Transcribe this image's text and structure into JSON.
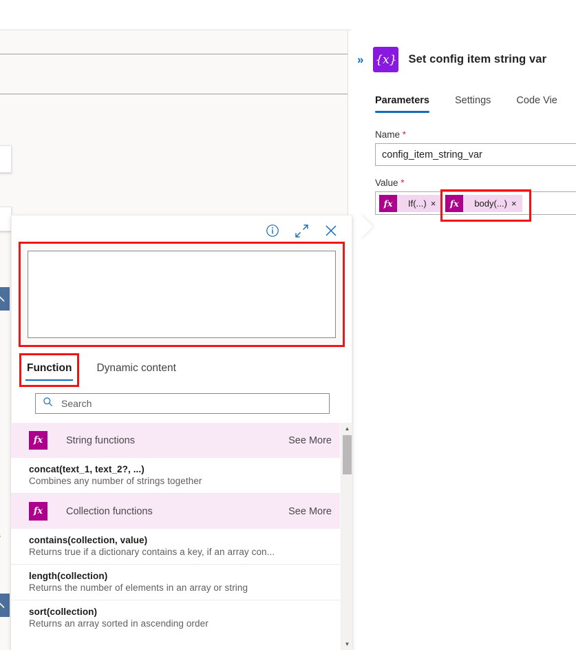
{
  "side_pane": {
    "expand_chevron": "»",
    "node_icon_glyph": "{x}",
    "title": "Set config item string var",
    "tabs": [
      {
        "label": "Parameters",
        "active": true
      },
      {
        "label": "Settings",
        "active": false
      },
      {
        "label": "Code Vie",
        "active": false
      }
    ],
    "fields": {
      "name_label": "Name",
      "name_required": "*",
      "name_value": "config_item_string_var",
      "value_label": "Value",
      "value_required": "*",
      "tokens": [
        {
          "fx": "fx",
          "label": "If(...)",
          "close": "×",
          "highlighted": false
        },
        {
          "fx": "fx",
          "label": "body(...)",
          "close": "×",
          "highlighted": true
        }
      ]
    }
  },
  "flyout": {
    "toolbar": {
      "info_icon": "info-icon",
      "expand_icon": "expand-icon",
      "close_icon": "close-icon"
    },
    "expression_value": "",
    "tabs": [
      {
        "label": "Function",
        "active": true,
        "highlighted": true
      },
      {
        "label": "Dynamic content",
        "active": false,
        "highlighted": false
      }
    ],
    "search": {
      "placeholder": "Search",
      "value": "",
      "icon": "search-icon"
    },
    "groups": [
      {
        "name": "String functions",
        "see_more": "See More",
        "fx": "fx",
        "functions": [
          {
            "signature": "concat(text_1, text_2?, ...)",
            "description": "Combines any number of strings together"
          }
        ]
      },
      {
        "name": "Collection functions",
        "see_more": "See More",
        "fx": "fx",
        "functions": [
          {
            "signature": "contains(collection, value)",
            "description": "Returns true if a dictionary contains a key, if an array con..."
          },
          {
            "signature": "length(collection)",
            "description": "Returns the number of elements in an array or string"
          },
          {
            "signature": "sort(collection)",
            "description": "Returns an array sorted in ascending order"
          }
        ]
      }
    ],
    "scrollbar": {
      "up_arrow": "▲",
      "down_arrow": "▼"
    }
  },
  "canvas": {
    "clipped_text": "es",
    "collapse_buttons": [
      {
        "icon": "chevron-up-icon"
      },
      {
        "icon": "chevron-up-icon"
      }
    ]
  },
  "colors": {
    "accent_blue": "#0f6cbd",
    "node_purple": "#8a19e0",
    "token_magenta": "#ad008c",
    "token_bg": "#f2d6ef",
    "group_bg": "#f9e9f6",
    "highlight_red": "#f01414",
    "required_red": "#c4314b",
    "collapse_blue": "#4c6f9c"
  }
}
